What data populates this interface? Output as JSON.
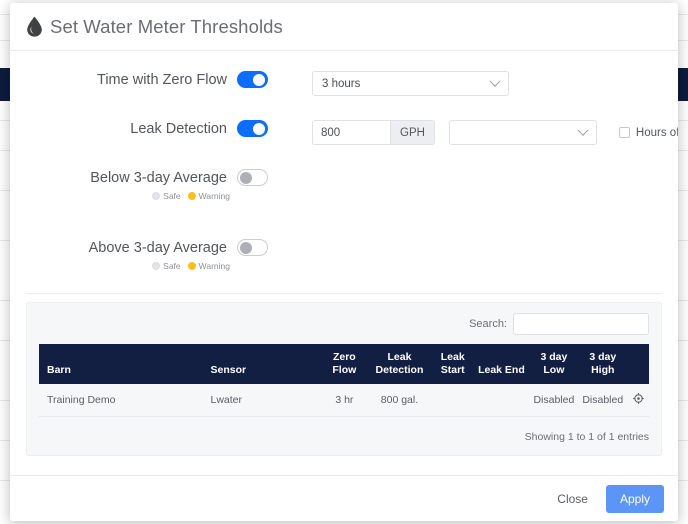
{
  "backdrop": {
    "navbar_color": "#0d1b3e"
  },
  "modal": {
    "title": "Set Water Meter Thresholds",
    "icon": "water-drop-icon"
  },
  "form": {
    "rows": [
      {
        "label": "Time with Zero Flow",
        "toggle_state": "on",
        "select_value": "3 hours"
      },
      {
        "label": "Leak Detection",
        "toggle_state": "on",
        "input_value": "800",
        "unit": "GPH",
        "select_value": "",
        "checkbox_label": "Hours of Alarm",
        "checkbox_checked": "false"
      },
      {
        "label": "Below 3-day Average",
        "toggle_state": "off",
        "safe_label": "Safe",
        "warning_label": "Warning",
        "selected_severity": "Warning"
      },
      {
        "label": "Above 3-day Average",
        "toggle_state": "off",
        "safe_label": "Safe",
        "warning_label": "Warning",
        "selected_severity": "Warning"
      }
    ]
  },
  "table": {
    "search_label": "Search:",
    "search_value": "",
    "search_placeholder": "",
    "columns": [
      "Barn",
      "Sensor",
      "Zero Flow",
      "Leak Detection",
      "Leak Start",
      "Leak End",
      "3 day Low",
      "3 day High"
    ],
    "columns_split": [
      {
        "line1": "",
        "line2": "Barn"
      },
      {
        "line1": "",
        "line2": "Sensor"
      },
      {
        "line1": "Zero",
        "line2": "Flow"
      },
      {
        "line1": "Leak",
        "line2": "Detection"
      },
      {
        "line1": "Leak",
        "line2": "Start"
      },
      {
        "line1": "",
        "line2": "Leak End"
      },
      {
        "line1": "3 day",
        "line2": "Low"
      },
      {
        "line1": "3 day",
        "line2": "High"
      }
    ],
    "rows": [
      {
        "barn": "Training Demo",
        "sensor": "Lwater",
        "zero_flow": "3 hr",
        "leak_detection": "800 gal.",
        "leak_start": "",
        "leak_end": "",
        "three_day_low": "Disabled",
        "three_day_high": "Disabled",
        "action_icon": "gear-icon"
      }
    ],
    "entries_text": "Showing 1 to 1 of 1 entries"
  },
  "footer": {
    "close_label": "Close",
    "apply_label": "Apply",
    "apply_color": "#5b96f7"
  },
  "colors": {
    "toggle_on": "#0d6efd",
    "toggle_off_knob": "#adb0b5",
    "warning_dot": "#fcbf1e",
    "table_header": "#121f42"
  }
}
